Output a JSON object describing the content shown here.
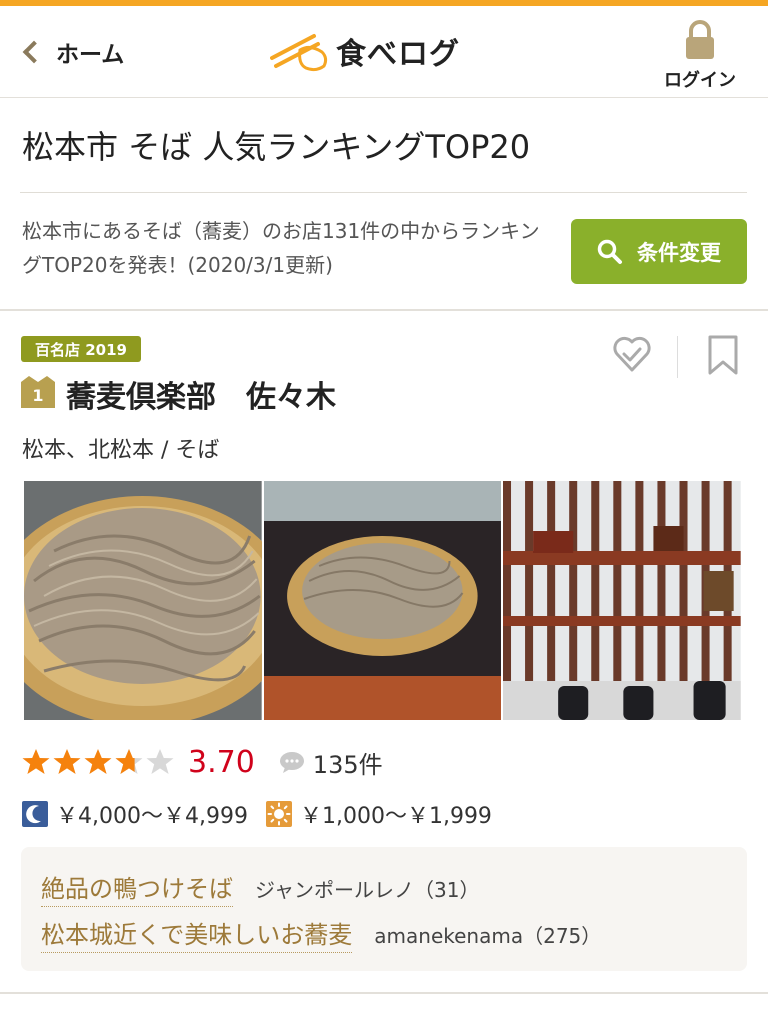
{
  "header": {
    "back_label": "ホーム",
    "logo_text": "食べログ",
    "login_label": "ログイン"
  },
  "page": {
    "title": "松本市 そば 人気ランキングTOP20",
    "intro": "松本市にあるそば（蕎麦）のお店131件の中からランキングTOP20を発表！(2020/3/1更新)",
    "condition_button": "条件変更"
  },
  "listing": {
    "badge": "百名店 2019",
    "rank": "1",
    "name": "蕎麦倶楽部　佐々木",
    "area": "松本、北松本 / そば",
    "rating": 3.7,
    "rating_text": "3.70",
    "review_count": "135件",
    "dinner_price": "￥4,000～￥4,999",
    "lunch_price": "￥1,000～￥1,999",
    "photos": [
      "zaru-soba-closeup",
      "zaru-soba-on-tray",
      "shop-interior"
    ],
    "reviews": [
      {
        "title": "絶品の鴨つけそば",
        "user": "ジャンポールレノ（31）"
      },
      {
        "title": "松本城近くで美味しいお蕎麦",
        "user": "amanekenama（275）"
      }
    ]
  },
  "colors": {
    "accent": "#f5a623",
    "button": "#8ab02b",
    "badge": "#8f9a1f",
    "star": "#f5820d",
    "score": "#d0021b",
    "review_title": "#9d7a3a"
  },
  "icons": {
    "back": "chevron-left-icon",
    "login": "lock-icon",
    "search": "search-icon",
    "saved": "check-heart-icon",
    "bookmark": "bookmark-icon",
    "dinner": "moon-icon",
    "lunch": "sun-icon",
    "reviews": "speech-bubble-icon"
  }
}
